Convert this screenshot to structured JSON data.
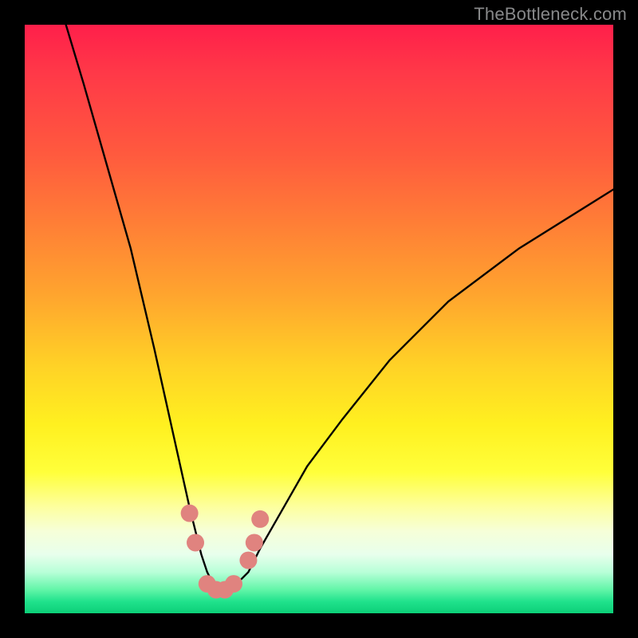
{
  "watermark": "TheBottleneck.com",
  "chart_data": {
    "type": "line",
    "title": "",
    "xlabel": "",
    "ylabel": "",
    "xlim": [
      0,
      100
    ],
    "ylim": [
      0,
      100
    ],
    "grid": false,
    "legend": false,
    "series": [
      {
        "name": "bottleneck-curve",
        "color": "#000000",
        "x": [
          7,
          10,
          14,
          18,
          22,
          24,
          26,
          28,
          30,
          31,
          32,
          33,
          34,
          35,
          36,
          38,
          40,
          44,
          48,
          54,
          62,
          72,
          84,
          100
        ],
        "y": [
          100,
          90,
          76,
          62,
          45,
          36,
          27,
          18,
          10,
          7,
          5,
          4,
          4,
          4,
          5,
          7,
          11,
          18,
          25,
          33,
          43,
          53,
          62,
          72
        ]
      }
    ],
    "markers": [
      {
        "name": "marker-cluster",
        "color": "#e0837f",
        "points": [
          {
            "x": 28.0,
            "y": 17
          },
          {
            "x": 29.0,
            "y": 12
          },
          {
            "x": 31.0,
            "y": 5
          },
          {
            "x": 32.5,
            "y": 4
          },
          {
            "x": 34.0,
            "y": 4
          },
          {
            "x": 35.5,
            "y": 5
          },
          {
            "x": 38.0,
            "y": 9
          },
          {
            "x": 39.0,
            "y": 12
          },
          {
            "x": 40.0,
            "y": 16
          }
        ]
      }
    ],
    "background_gradient": {
      "top": "#ff1f4a",
      "mid": "#fff020",
      "bottom": "#0ccf78"
    }
  }
}
